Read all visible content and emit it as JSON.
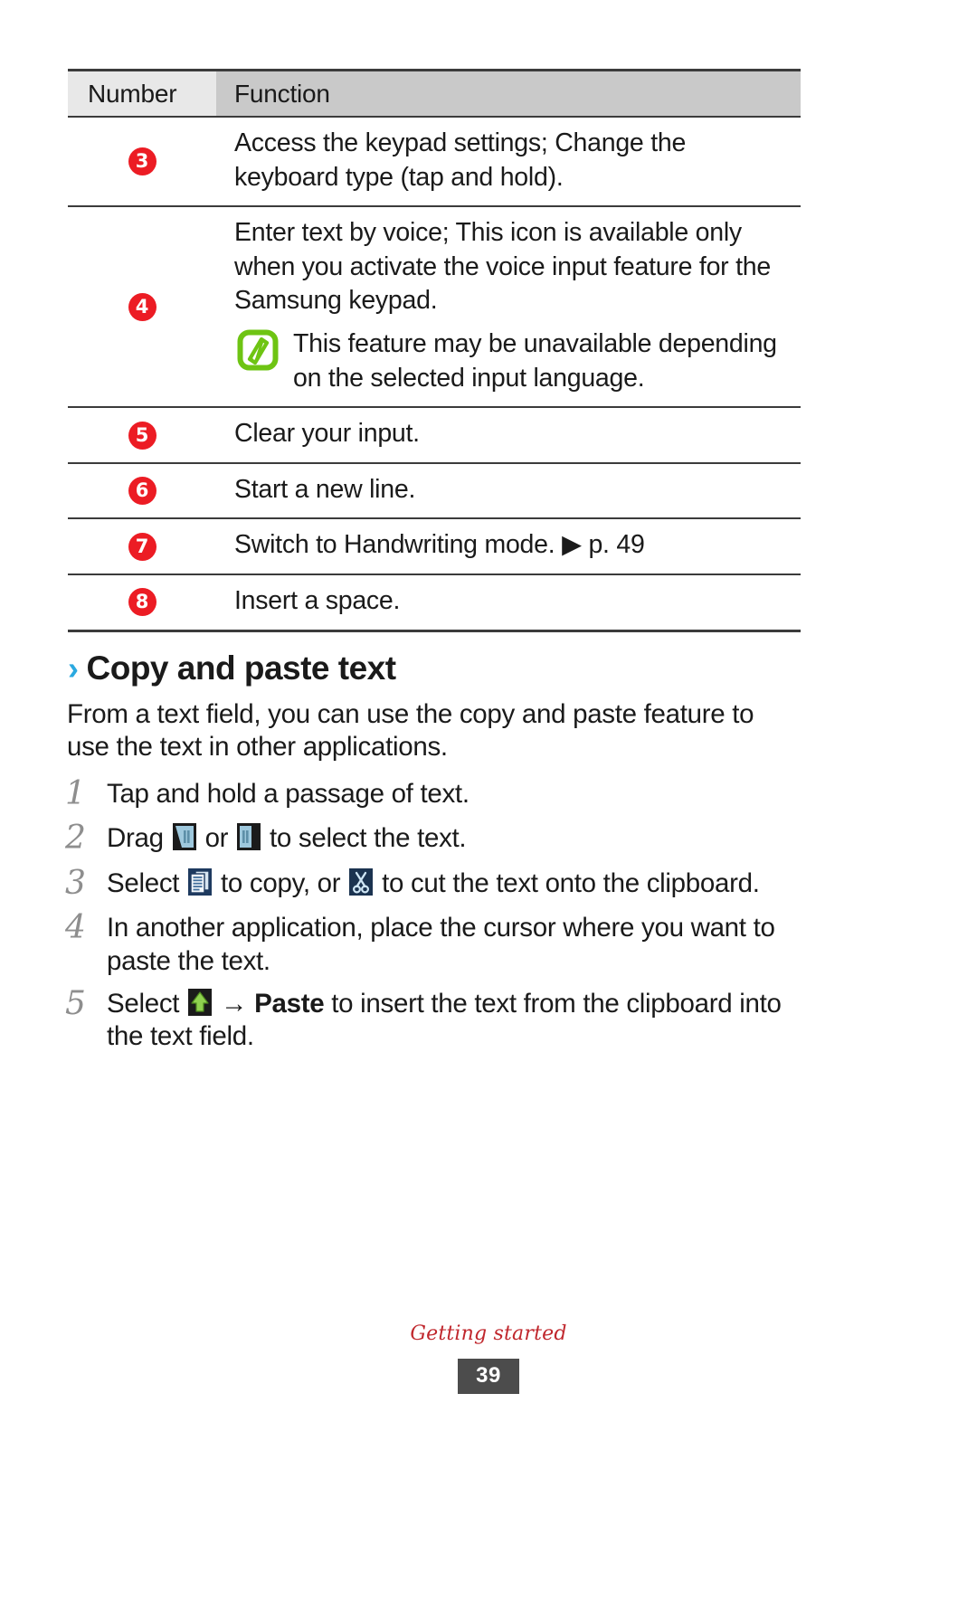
{
  "table": {
    "headers": [
      "Number",
      "Function"
    ],
    "rows": [
      {
        "number": "3",
        "function": "Access the keypad settings; Change the keyboard type (tap and hold)."
      },
      {
        "number": "4",
        "function": "Enter text by voice; This icon is available only when you activate the voice input feature for the Samsung keypad.",
        "note": {
          "icon": "note-pencil-icon",
          "text": "This feature may be unavailable depending on the selected input language."
        }
      },
      {
        "number": "5",
        "function": "Clear your input."
      },
      {
        "number": "6",
        "function": "Start a new line."
      },
      {
        "number": "7",
        "function_prefix": "Switch to Handwriting mode.",
        "function_ref_arrow": "▶",
        "function_ref": "p. 49"
      },
      {
        "number": "8",
        "function": "Insert a space."
      }
    ]
  },
  "section": {
    "chevron": "›",
    "title": "Copy and paste text",
    "intro": "From a text field, you can use the copy and paste feature to use the text in other applications."
  },
  "steps": [
    {
      "number": "1",
      "text": "Tap and hold a passage of text."
    },
    {
      "number": "2",
      "pre": "Drag",
      "icon1": "selection-handle-left-icon",
      "mid": "or",
      "icon2": "selection-handle-right-icon",
      "post": "to select the text."
    },
    {
      "number": "3",
      "pre": "Select",
      "icon1": "copy-icon",
      "mid": "to copy, or",
      "icon2": "cut-scissors-icon",
      "post": "to cut the text onto the clipboard."
    },
    {
      "number": "4",
      "text": "In another application, place the cursor where you want to paste the text."
    },
    {
      "number": "5",
      "pre": "Select",
      "icon1": "paste-clipboard-icon",
      "arrow": "→",
      "bold": "Paste",
      "post": "to insert the text from the clipboard into the text field."
    }
  ],
  "footer": {
    "label": "Getting started",
    "page": "39"
  },
  "colors": {
    "circle_number_bg": "#ec1c24",
    "note_icon_green": "#6ec413",
    "section_chevron_blue": "#2aa9e0",
    "footer_label_red": "#c0272d",
    "page_badge_bg": "#4c4c4c",
    "header_num_bg": "#e8e8e8",
    "header_fn_bg": "#c9c9c9"
  }
}
